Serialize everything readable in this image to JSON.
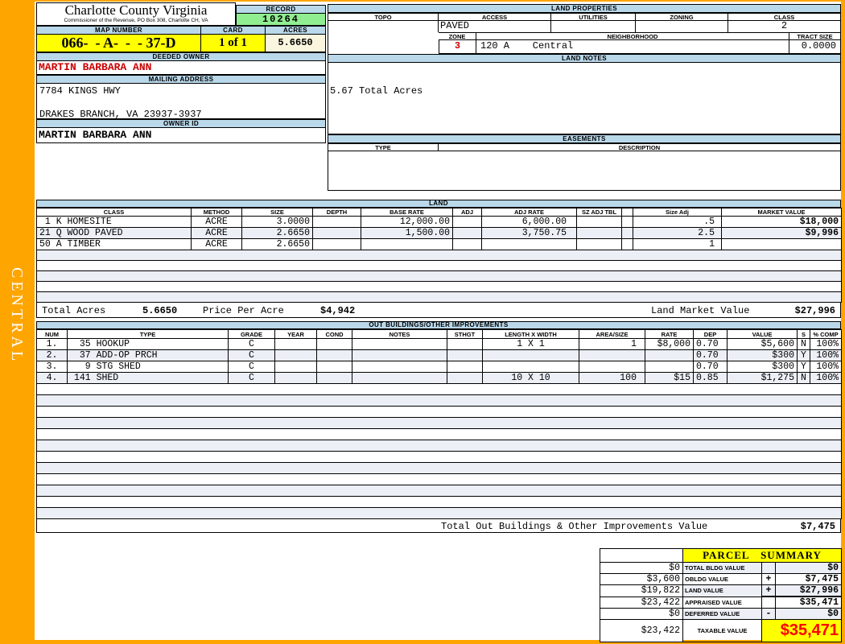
{
  "colors": {
    "frame_orange": "#FFA500",
    "section_header_blue": "#B9D8EA",
    "record_green": "#90EE90",
    "highlight_yellow": "#FFFF00",
    "acres_cream": "#FAF5DE",
    "owner_red": "#CC0000",
    "taxable_red": "#FF0000",
    "row_stripe": "#ECEFF6"
  },
  "frame": {
    "sidebar_label": "CENTRAL"
  },
  "header": {
    "county_title": "Charlotte County Virginia",
    "county_subtitle": "Commissioner of the Revenue, PO Box 308, Charlotte CH, VA",
    "record_label": "RECORD",
    "record_value": "10264",
    "map_number_label": "MAP NUMBER",
    "map_number_value": "066-  - A-  -  - 37-D",
    "card_label": "CARD",
    "card_value": "1 of 1",
    "acres_label": "ACRES",
    "acres_value": "5.6650"
  },
  "owner": {
    "deeded_owner_label": "DEEDED OWNER",
    "deeded_owner": "MARTIN BARBARA ANN",
    "mailing_address_label": "MAILING ADDRESS",
    "address_line1": "7784 KINGS HWY",
    "address_line2": "DRAKES BRANCH, VA 23937-3937",
    "owner_id_label": "OWNER ID",
    "owner_id": "MARTIN BARBARA ANN"
  },
  "land_properties": {
    "title": "LAND PROPERTIES",
    "headers": [
      "TOPO",
      "ACCESS",
      "UTILITIES",
      "ZONING",
      "CLASS"
    ],
    "topo": "",
    "access": "PAVED",
    "utilities": "",
    "zoning": "",
    "class": "2",
    "zone_label": "ZONE",
    "zone": "3",
    "neighborhood_label": "NEIGHBORHOOD",
    "neighborhood": "120 A    Central",
    "tract_size_label": "TRACT SIZE",
    "tract_size": "0.0000"
  },
  "land_notes": {
    "title": "LAND NOTES",
    "note": "5.67 Total Acres"
  },
  "easements": {
    "title": "EASEMENTS",
    "type_label": "TYPE",
    "description_label": "DESCRIPTION"
  },
  "land": {
    "title": "LAND",
    "headers": [
      "CLASS",
      "METHOD",
      "SIZE",
      "DEPTH",
      "BASE RATE",
      "ADJ",
      "ADJ RATE",
      "SZ ADJ TBL",
      "",
      "Size Adj",
      "MARKET VALUE"
    ],
    "rows": [
      {
        "cls": " 1 K HOMESITE",
        "method": "ACRE",
        "size": "3.0000",
        "depth": "",
        "base_rate": "12,000.00",
        "adj": "",
        "adj_rate": "6,000.00",
        "sz_adj_tbl": "",
        "size_adj": ".5",
        "market_value": "$18,000"
      },
      {
        "cls": "21 Q WOOD PAVED",
        "method": "ACRE",
        "size": "2.6650",
        "depth": "",
        "base_rate": "1,500.00",
        "adj": "",
        "adj_rate": "3,750.75",
        "sz_adj_tbl": "",
        "size_adj": "2.5",
        "market_value": "$9,996"
      },
      {
        "cls": "50 A TIMBER",
        "method": "ACRE",
        "size": "2.6650",
        "depth": "",
        "base_rate": "",
        "adj": "",
        "adj_rate": "",
        "sz_adj_tbl": "",
        "size_adj": "1",
        "market_value": ""
      }
    ],
    "total_acres_label": "Total Acres",
    "total_acres": "5.6650",
    "price_per_acre_label": "Price Per Acre",
    "price_per_acre": "$4,942",
    "market_value_label": "Land Market Value",
    "market_value_total": "$27,996"
  },
  "out_buildings": {
    "title": "OUT BUILDINGS/OTHER IMPROVEMENTS",
    "headers": [
      "NUM",
      "TYPE",
      "GRADE",
      "YEAR",
      "COND",
      "NOTES",
      "STHGT",
      "LENGTH X WIDTH",
      "AREA/SIZE",
      "RATE",
      "DEP",
      "VALUE",
      "S",
      "% COMP"
    ],
    "rows": [
      {
        "num": "1.",
        "type": " 35 HOOKUP",
        "grade": "C",
        "year": "",
        "cond": "",
        "notes": "",
        "sthgt": "",
        "lxw": "1 X 1",
        "area": "1",
        "rate": "$8,000",
        "dep": "0.70",
        "value": "$5,600",
        "s": "N",
        "comp": "100%"
      },
      {
        "num": "2.",
        "type": " 37 ADD-OP PRCH",
        "grade": "C",
        "year": "",
        "cond": "",
        "notes": "",
        "sthgt": "",
        "lxw": "",
        "area": "",
        "rate": "",
        "dep": "0.70",
        "value": "$300",
        "s": "Y",
        "comp": "100%"
      },
      {
        "num": "3.",
        "type": "  9 STG SHED",
        "grade": "C",
        "year": "",
        "cond": "",
        "notes": "",
        "sthgt": "",
        "lxw": "",
        "area": "",
        "rate": "",
        "dep": "0.70",
        "value": "$300",
        "s": "Y",
        "comp": "100%"
      },
      {
        "num": "4.",
        "type": "141 SHED",
        "grade": "C",
        "year": "",
        "cond": "",
        "notes": "",
        "sthgt": "",
        "lxw": "10 X 10",
        "area": "100",
        "rate": "$15",
        "dep": "0.85",
        "value": "$1,275",
        "s": "N",
        "comp": "100%"
      }
    ],
    "total_label": "Total Out Buildings & Other Improvements Value",
    "total_value": "$7,475"
  },
  "parcel_summary": {
    "title": "PARCEL SUMMARY",
    "rows": [
      {
        "left": "$0",
        "label": "TOTAL BLDG VALUE",
        "sign": "",
        "right": "$0"
      },
      {
        "left": "$3,600",
        "label": "OBLDG VALUE",
        "sign": "+",
        "right": "$7,475"
      },
      {
        "left": "$19,822",
        "label": "LAND VALUE",
        "sign": "+",
        "right": "$27,996"
      },
      {
        "left": "$23,422",
        "label": "APPRAISED VALUE",
        "sign": "",
        "right": "$35,471"
      },
      {
        "left": "$0",
        "label": "DEFERRED VALUE",
        "sign": "-",
        "right": "$0"
      }
    ],
    "taxable": {
      "left": "$23,422",
      "label": "TAXABLE VALUE",
      "value": "$35,471"
    }
  }
}
